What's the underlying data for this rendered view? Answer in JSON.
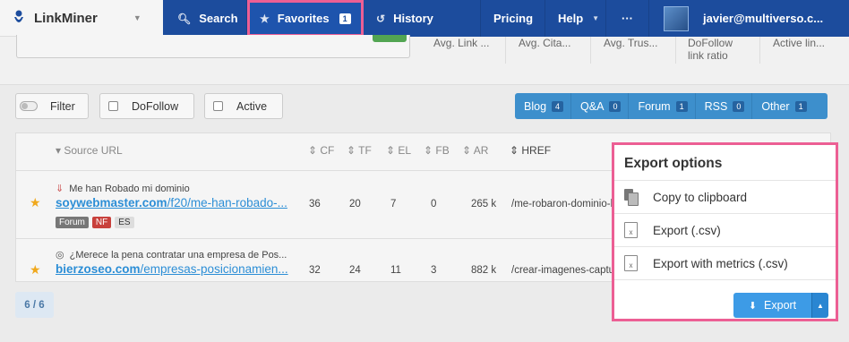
{
  "app": {
    "name": "LinkMiner"
  },
  "nav": {
    "search": "Search",
    "favorites": "Favorites",
    "favorites_count": "1",
    "history": "History",
    "pricing": "Pricing",
    "help": "Help",
    "more": "···",
    "user": "javier@multiverso.c..."
  },
  "metrics": [
    {
      "label": "Avg. Link ..."
    },
    {
      "label": "Avg. Cita..."
    },
    {
      "label": "Avg. Trus..."
    },
    {
      "label": "DoFollow link ratio"
    },
    {
      "label": "Active lin..."
    }
  ],
  "filters": {
    "filter": "Filter",
    "dofollow": "DoFollow",
    "active": "Active"
  },
  "categories": [
    {
      "label": "Blog",
      "count": "4"
    },
    {
      "label": "Q&A",
      "count": "0"
    },
    {
      "label": "Forum",
      "count": "1"
    },
    {
      "label": "RSS",
      "count": "0"
    },
    {
      "label": "Other",
      "count": "1"
    }
  ],
  "table": {
    "headers": {
      "source": "Source URL",
      "cf": "CF",
      "tf": "TF",
      "el": "EL",
      "fb": "FB",
      "ar": "AR",
      "href": "HREF"
    },
    "rows": [
      {
        "title": "Me han Robado mi dominio",
        "domain": "soywebmaster.com",
        "path": "/f20/me-han-robado-...",
        "tags": [
          "Forum",
          "NF",
          "ES"
        ],
        "cf": "36",
        "tf": "20",
        "el": "7",
        "fb": "0",
        "ar": "265 k",
        "href": "/me-robaron-dominio-lo"
      },
      {
        "title": "¿Merece la pena contratar una empresa de Pos...",
        "domain": "bierzoseo.com",
        "path": "/empresas-posicionamien...",
        "tags": [],
        "cf": "32",
        "tf": "24",
        "el": "11",
        "fb": "3",
        "ar": "882 k",
        "href": "/crear-imagenes-captur"
      }
    ]
  },
  "pager": "6 / 6",
  "export_menu": {
    "title": "Export options",
    "items": [
      "Copy to clipboard",
      "Export (.csv)",
      "Export with metrics (.csv)"
    ],
    "button": "Export"
  },
  "colors": {
    "nav": "#1c4c9d",
    "highlight": "#ec5f94",
    "link": "#2c8ed6",
    "categories": "#3d8fcc",
    "star": "#f0a81c"
  }
}
